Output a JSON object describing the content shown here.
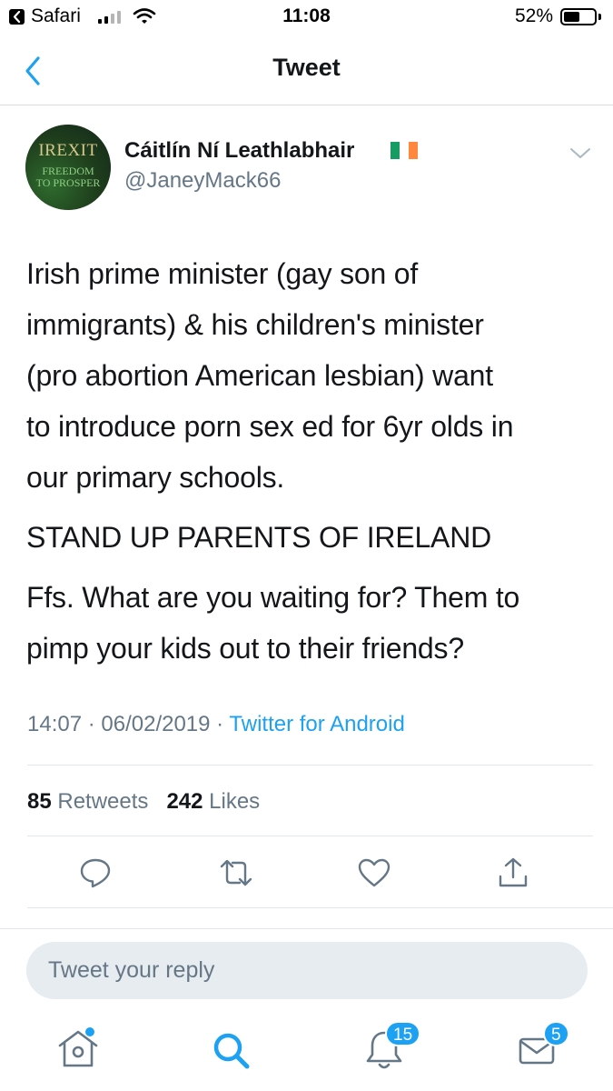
{
  "status_bar": {
    "carrier": "Safari",
    "time": "11:08",
    "battery_percent": "52%",
    "battery_level": 0.52,
    "signal_bars_filled": 2,
    "signal_bars_total": 4
  },
  "nav": {
    "title": "Tweet",
    "back_icon": "chevron-left-icon"
  },
  "tweet": {
    "avatar_text": [
      "IREXIT",
      "FREEDOM",
      "TO PROSPER"
    ],
    "display_name": "Cáitlín Ní Leathlabhair",
    "flag_colors": [
      "#169b62",
      "#ffffff",
      "#ff883e"
    ],
    "handle": "@JaneyMack66",
    "paragraphs": [
      "Irish prime minister (gay son of\nimmigrants) & his children's minister\n(pro abortion American lesbian) want\nto introduce porn sex ed for 6yr olds in\nour primary schools.",
      "STAND UP PARENTS OF IRELAND",
      "Ffs. What are you waiting for? Them to\npimp your kids out to their friends?"
    ],
    "timestamp": "14:07 · 06/02/2019 · ",
    "source": "Twitter for Android",
    "retweet_count": "85",
    "retweet_label": " Retweets",
    "like_count": "242",
    "like_label": " Likes"
  },
  "actions": [
    {
      "name": "reply-icon"
    },
    {
      "name": "retweet-icon"
    },
    {
      "name": "like-icon"
    },
    {
      "name": "share-icon"
    }
  ],
  "reply": {
    "placeholder": "Tweet your reply"
  },
  "tabs": {
    "notifications_badge": "15",
    "messages_badge": "5"
  },
  "colors": {
    "accent": "#1da1f2",
    "text": "#14171a",
    "secondary": "#657786"
  }
}
